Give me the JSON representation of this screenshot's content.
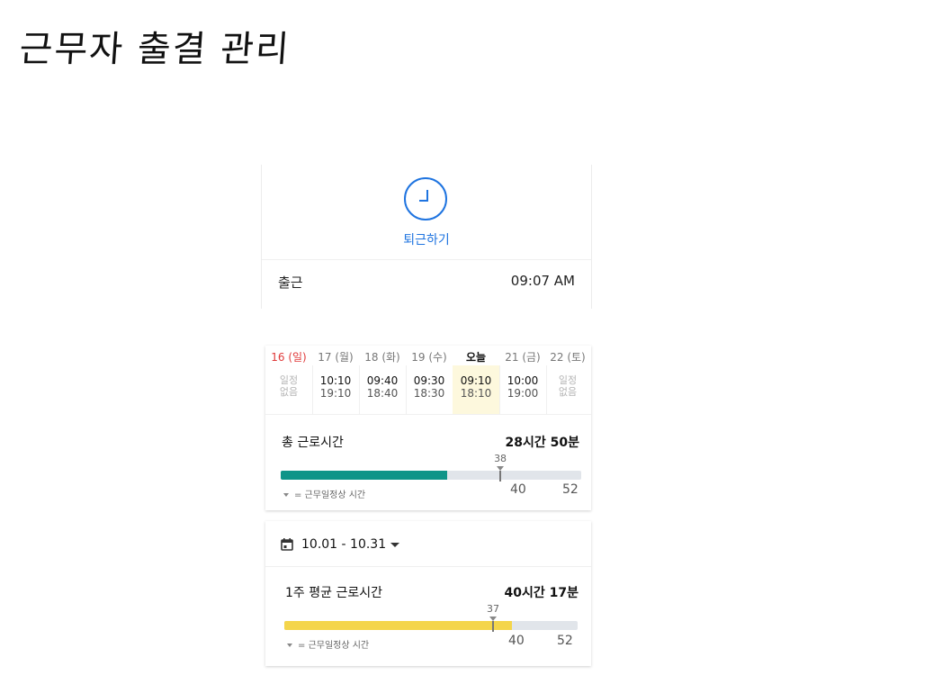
{
  "page": {
    "title": "근무자 출결 관리"
  },
  "clock": {
    "button_label": "퇴근하기",
    "clock_in_label": "출근",
    "clock_in_time": "09:07 AM",
    "accent_color": "#1f74e0"
  },
  "week": {
    "days": [
      {
        "label": "16 (일)",
        "none": "일정\n없음",
        "type": "sunday"
      },
      {
        "label": "17 (월)",
        "in": "10:10",
        "out": "19:10"
      },
      {
        "label": "18 (화)",
        "in": "09:40",
        "out": "18:40"
      },
      {
        "label": "19 (수)",
        "in": "09:30",
        "out": "18:30"
      },
      {
        "label": "오늘",
        "in": "09:10",
        "out": "18:10",
        "type": "today"
      },
      {
        "label": "21 (금)",
        "in": "10:00",
        "out": "19:00"
      },
      {
        "label": "22 (토)",
        "none": "일정\n없음"
      }
    ],
    "total_label": "총 근로시간",
    "total_value": "28시간 50분",
    "normal_marker": "38",
    "normal_marker_hours": 38,
    "progress_hours": 28.83,
    "axis_max_hours": 52,
    "axis_40": "40",
    "axis_52": "52",
    "bar_color": "#0f9488",
    "legend": "= 근무일정상 시간"
  },
  "month": {
    "range": "10.01 - 10.31",
    "avg_label": "1주 평균 근로시간",
    "avg_value": "40시간 17분",
    "normal_marker": "37",
    "normal_marker_hours": 37,
    "progress_hours": 40.28,
    "axis_max_hours": 52,
    "axis_40": "40",
    "axis_52": "52",
    "bar_color": "#f4d54b",
    "legend": "= 근무일정상 시간"
  }
}
